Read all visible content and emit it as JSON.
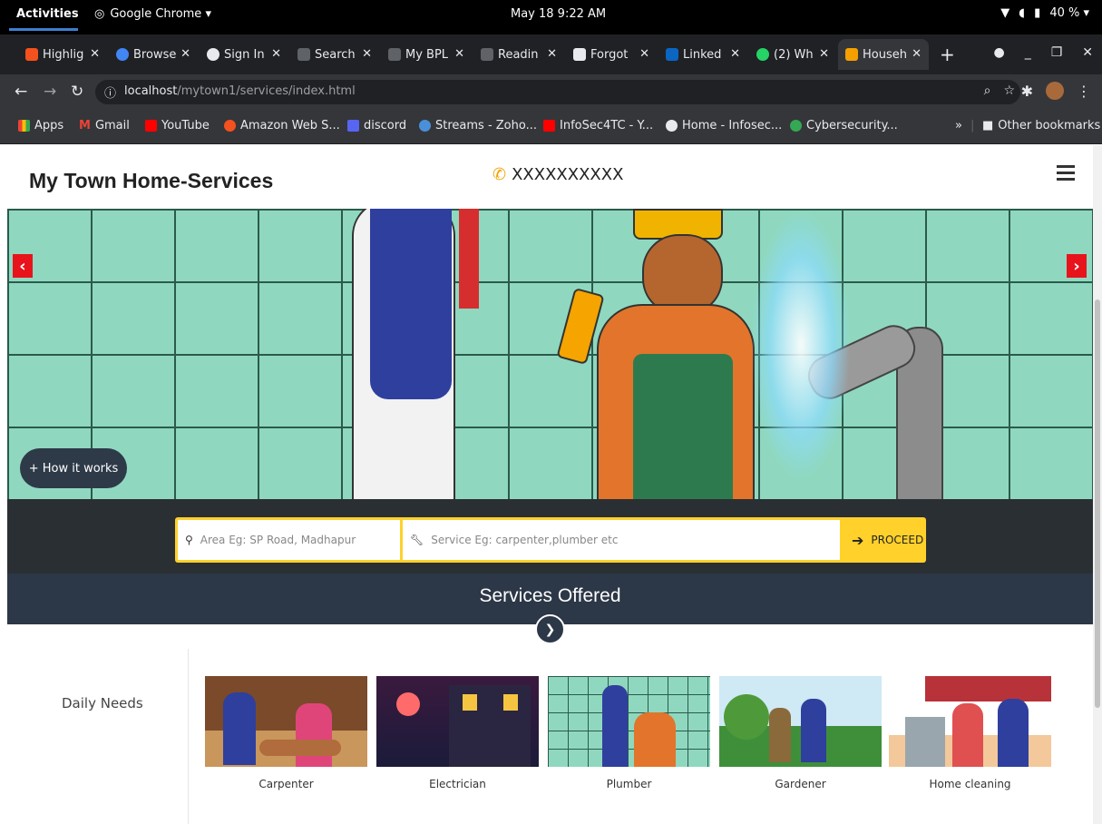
{
  "system": {
    "activities": "Activities",
    "app_name": "Google Chrome ▾",
    "clock": "May 18  9:22 AM",
    "battery": "40 % ▾"
  },
  "tabs": [
    {
      "label": "Highlig",
      "color": "#f4511e"
    },
    {
      "label": "Browse",
      "color": "#4285f4"
    },
    {
      "label": "Sign In",
      "color": "#e8eaed"
    },
    {
      "label": "Search",
      "color": "#9aa0a6"
    },
    {
      "label": "My BPL",
      "color": "#9aa0a6"
    },
    {
      "label": "Readin",
      "color": "#9aa0a6"
    },
    {
      "label": "Forgot",
      "color": "#e8eaed"
    },
    {
      "label": "Linked",
      "color": "#0a66c2"
    },
    {
      "label": "(2) Wh",
      "color": "#25d366"
    },
    {
      "label": "Househ",
      "color": "#f4a100"
    }
  ],
  "browser": {
    "url_host": "localhost",
    "url_path": "/mytown1/services/index.html"
  },
  "bookmarks": [
    {
      "label": "Apps",
      "color": "#ea4335"
    },
    {
      "label": "Gmail",
      "color": "#ea4335"
    },
    {
      "label": "YouTube",
      "color": "#ff0000"
    },
    {
      "label": "Amazon Web S...",
      "color": "#f4511e"
    },
    {
      "label": "discord",
      "color": "#5865f2"
    },
    {
      "label": "Streams - Zoho...",
      "color": "#4a90d9"
    },
    {
      "label": "InfoSec4TC - Y...",
      "color": "#ff0000"
    },
    {
      "label": "Home - Infosec...",
      "color": "#e8eaed"
    },
    {
      "label": "Cybersecurity...",
      "color": "#34a853"
    }
  ],
  "other_bookmarks": "Other bookmarks",
  "site": {
    "title": "My Town Home-Services",
    "phone": "XXXXXXXXXX"
  },
  "hero": {
    "how_it_works": "+ How it works",
    "area_placeholder": "Area Eg: SP Road, Madhapur",
    "service_placeholder": "Service Eg: carpenter,plumber etc",
    "proceed": "PROCEED"
  },
  "services": {
    "heading": "Services Offered",
    "category": "Daily Needs",
    "items": [
      "Carpenter",
      "Electrician",
      "Plumber",
      "Gardener",
      "Home cleaning"
    ]
  }
}
